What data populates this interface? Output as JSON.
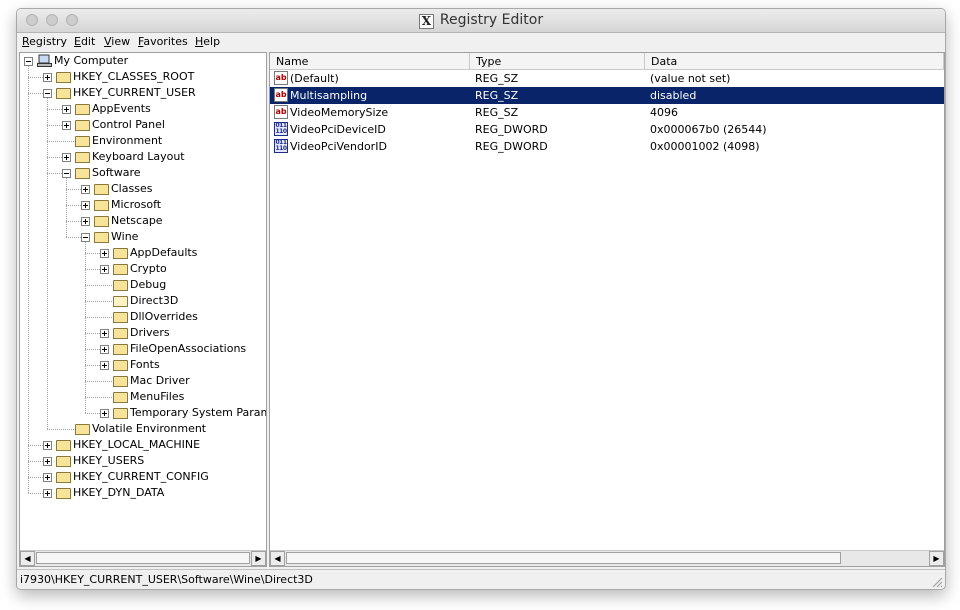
{
  "window": {
    "title": "Registry Editor"
  },
  "menu": [
    {
      "label": "Registry",
      "mnemonic": "R",
      "rest": "egistry"
    },
    {
      "label": "Edit",
      "mnemonic": "E",
      "rest": "dit"
    },
    {
      "label": "View",
      "mnemonic": "V",
      "rest": "iew"
    },
    {
      "label": "Favorites",
      "mnemonic": "F",
      "rest": "avorites"
    },
    {
      "label": "Help",
      "mnemonic": "H",
      "rest": "elp"
    }
  ],
  "tree": [
    {
      "label": "My Computer",
      "depth": 0,
      "expander": "minus",
      "icon": "computer-icon"
    },
    {
      "label": "HKEY_CLASSES_ROOT",
      "depth": 1,
      "expander": "plus",
      "icon": "folder-icon"
    },
    {
      "label": "HKEY_CURRENT_USER",
      "depth": 1,
      "expander": "minus",
      "icon": "folder-icon"
    },
    {
      "label": "AppEvents",
      "depth": 2,
      "expander": "plus",
      "icon": "folder-icon"
    },
    {
      "label": "Control Panel",
      "depth": 2,
      "expander": "plus",
      "icon": "folder-icon"
    },
    {
      "label": "Environment",
      "depth": 2,
      "expander": "none",
      "icon": "folder-icon"
    },
    {
      "label": "Keyboard Layout",
      "depth": 2,
      "expander": "plus",
      "icon": "folder-icon"
    },
    {
      "label": "Software",
      "depth": 2,
      "expander": "minus",
      "icon": "folder-icon"
    },
    {
      "label": "Classes",
      "depth": 3,
      "expander": "plus",
      "icon": "folder-icon"
    },
    {
      "label": "Microsoft",
      "depth": 3,
      "expander": "plus",
      "icon": "folder-icon"
    },
    {
      "label": "Netscape",
      "depth": 3,
      "expander": "plus",
      "icon": "folder-icon"
    },
    {
      "label": "Wine",
      "depth": 3,
      "expander": "minus",
      "icon": "folder-icon"
    },
    {
      "label": "AppDefaults",
      "depth": 4,
      "expander": "plus",
      "icon": "folder-icon"
    },
    {
      "label": "Crypto",
      "depth": 4,
      "expander": "plus",
      "icon": "folder-icon"
    },
    {
      "label": "Debug",
      "depth": 4,
      "expander": "none",
      "icon": "folder-icon"
    },
    {
      "label": "Direct3D",
      "depth": 4,
      "expander": "none",
      "icon": "folder-open-icon"
    },
    {
      "label": "DllOverrides",
      "depth": 4,
      "expander": "none",
      "icon": "folder-icon"
    },
    {
      "label": "Drivers",
      "depth": 4,
      "expander": "plus",
      "icon": "folder-icon"
    },
    {
      "label": "FileOpenAssociations",
      "depth": 4,
      "expander": "plus",
      "icon": "folder-icon"
    },
    {
      "label": "Fonts",
      "depth": 4,
      "expander": "plus",
      "icon": "folder-icon"
    },
    {
      "label": "Mac Driver",
      "depth": 4,
      "expander": "none",
      "icon": "folder-icon"
    },
    {
      "label": "MenuFiles",
      "depth": 4,
      "expander": "none",
      "icon": "folder-icon"
    },
    {
      "label": "Temporary System Paramet",
      "depth": 4,
      "expander": "plus",
      "icon": "folder-icon"
    },
    {
      "label": "Volatile Environment",
      "depth": 2,
      "expander": "none",
      "icon": "folder-icon"
    },
    {
      "label": "HKEY_LOCAL_MACHINE",
      "depth": 1,
      "expander": "plus",
      "icon": "folder-icon"
    },
    {
      "label": "HKEY_USERS",
      "depth": 1,
      "expander": "plus",
      "icon": "folder-icon"
    },
    {
      "label": "HKEY_CURRENT_CONFIG",
      "depth": 1,
      "expander": "plus",
      "icon": "folder-icon"
    },
    {
      "label": "HKEY_DYN_DATA",
      "depth": 1,
      "expander": "plus",
      "icon": "folder-icon"
    }
  ],
  "list": {
    "columns": [
      "Name",
      "Type",
      "Data"
    ],
    "rows": [
      {
        "name": "(Default)",
        "type": "REG_SZ",
        "data": "(value not set)",
        "icon": "string-value-icon",
        "selected": false
      },
      {
        "name": "Multisampling",
        "type": "REG_SZ",
        "data": "disabled",
        "icon": "string-value-icon",
        "selected": true
      },
      {
        "name": "VideoMemorySize",
        "type": "REG_SZ",
        "data": "4096",
        "icon": "string-value-icon",
        "selected": false
      },
      {
        "name": "VideoPciDeviceID",
        "type": "REG_DWORD",
        "data": "0x000067b0 (26544)",
        "icon": "binary-value-icon",
        "selected": false
      },
      {
        "name": "VideoPciVendorID",
        "type": "REG_DWORD",
        "data": "0x00001002 (4098)",
        "icon": "binary-value-icon",
        "selected": false
      }
    ]
  },
  "status": {
    "path": "i7930\\HKEY_CURRENT_USER\\Software\\Wine\\Direct3D"
  },
  "colors": {
    "selection": "#0a246a",
    "folder": "#f8e39a"
  }
}
